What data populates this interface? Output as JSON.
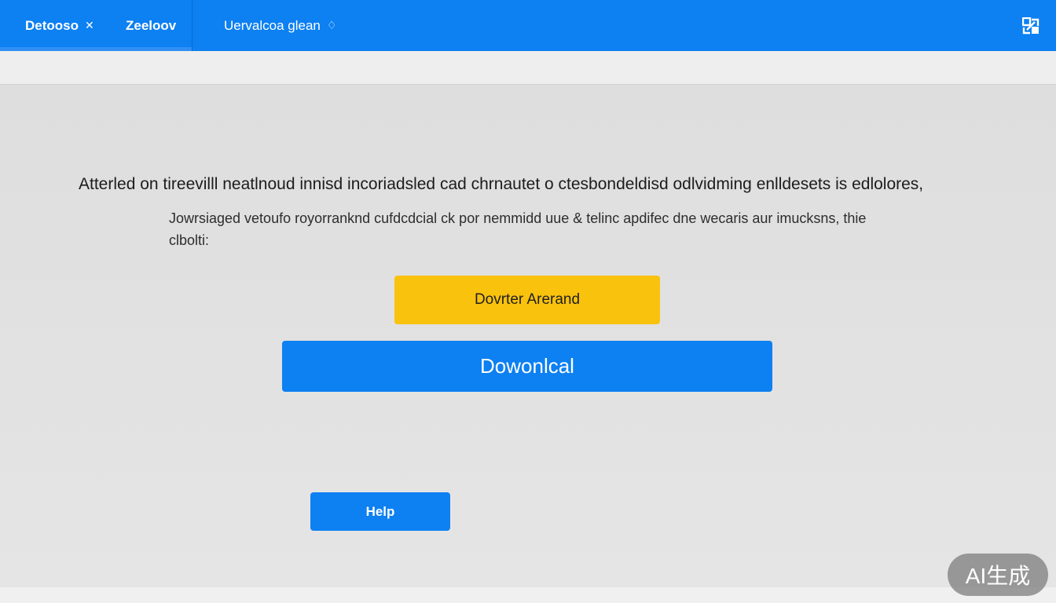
{
  "header": {
    "tabs": [
      {
        "label": "Detooso",
        "glyph": "✕"
      },
      {
        "label": "Zeeloov"
      },
      {
        "label": "Uervalcoa glean",
        "glyph": "♢"
      }
    ],
    "corner_icon": "window-switch-icon"
  },
  "main": {
    "headline": "Atterled on tireevilll neatlnoud innisd incoriadsled cad chrnautet o ctesbondeldisd odlvidming enlldesets is edlolores,",
    "subtext": "Jowrsiaged vetoufo royorranknd cufdcdcial ck por nemmidd uue & telinc apdifec dne wecaris aur imucksns, thie clbolti:",
    "primary_button": "Dovrter Arerand",
    "download_button": "Dowonlcal",
    "help_button": "Help"
  },
  "watermark": "AI生成",
  "colors": {
    "accent_blue": "#0d80f2",
    "accent_yellow": "#f9c20d",
    "panel_gray": "#dedede"
  }
}
